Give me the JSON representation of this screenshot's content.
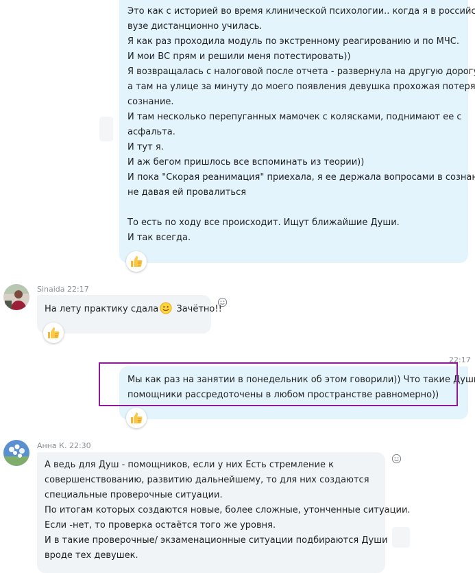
{
  "messages": [
    {
      "direction": "outgoing",
      "lines": [
        "Это как с историей во время клинической психологии.. когда я в российском",
        "вузе дистанционно училась.",
        "Я как раз проходила модуль по экстренному реагированию и по МЧС.",
        "И мои ВС прям и решили меня потестировать))",
        "Я возвращалась с налоговой после отчета - развернула на другую дорогу,",
        "а там на улице за минуту до моего появления девушка прохожая потеряла",
        "сознание.",
        "И там несколько перепуганных мамочек с колясками, поднимают ее с",
        "асфальта.",
        "И тут я.",
        "И аж бегом пришлось все вспоминать из теории))",
        "И пока \"Скорая реанимация\" приехала, я ее держала вопросами в сознании,",
        "не давая ей провалиться",
        "",
        "То есть по ходу все происходит. Ищут ближайшие Души.",
        "И так всегда."
      ],
      "reaction": "thumbs-up"
    },
    {
      "direction": "incoming",
      "sender": "Sinaida",
      "time": "22:17",
      "text_before": "На лету практику сдала",
      "emoji": "smiley",
      "text_after": " Зачётно!!",
      "reaction": "thumbs-up"
    },
    {
      "direction": "outgoing",
      "time": "22:17",
      "lines": [
        "Мы как раз на занятии в понедельник об этом говорили)) Что такие Души-",
        "помощники рассредоточены в любом пространстве равномерно))"
      ],
      "reaction": "thumbs-up",
      "highlighted": true
    },
    {
      "direction": "incoming",
      "sender": "Анна К.",
      "time": "22:30",
      "lines": [
        "А ведь для Душ - помощников, если у них Есть стремление к",
        "совершенствованию, развитию дальнейшему, то для них создаются",
        "специальные проверочные ситуации.",
        "По итогам которых создаются новые, более сложные, утонченные ситуации.",
        "Если -нет, то проверка остаётся  того же уровня.",
        "И в такие проверочные/ экзаменационные ситуации подбираются Души",
        "вроде тех девушек."
      ]
    }
  ],
  "colors": {
    "outgoing_bubble": "#e3f4fd",
    "incoming_bubble": "#f1f4f7",
    "highlight_border": "#8e1a9a",
    "meta_text": "#8a8f95"
  },
  "icons": {
    "reaction": "thumbs-up-icon",
    "add_reaction": "smiley-add-icon",
    "inline_emoji": "smiley-emoji-icon"
  }
}
